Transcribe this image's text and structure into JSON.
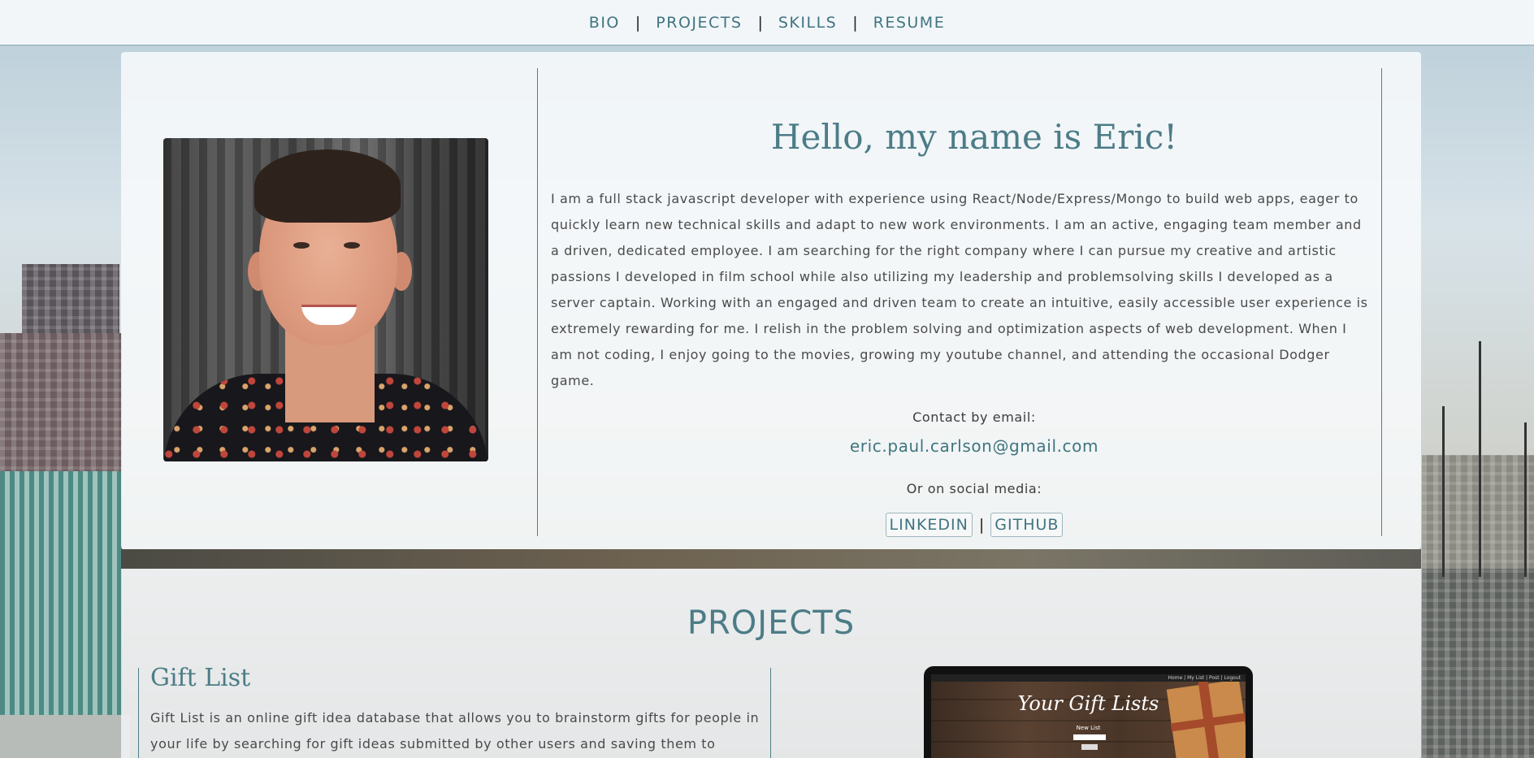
{
  "nav": {
    "items": [
      {
        "label": "BIO"
      },
      {
        "label": "PROJECTS"
      },
      {
        "label": "SKILLS"
      },
      {
        "label": "RESUME"
      }
    ],
    "separator": "|"
  },
  "bio": {
    "title": "Hello, my name is Eric!",
    "text": "I am a full stack javascript developer with experience using React/Node/Express/Mongo to build web apps, eager to quickly learn new technical skills and adapt to new work environments. I am an active, engaging team member and a driven, dedicated employee. I am searching for the right company where I can pursue my creative and artistic passions I developed in film school while also utilizing my leadership and problemsolving skills I developed as a server captain. Working with an engaged and driven team to create an intuitive, easily accessible user experience is extremely rewarding for me. I relish in the problem solving and optimization aspects of web development. When I am not coding, I enjoy going to the movies, growing my youtube channel, and attending the occasional Dodger game.",
    "contact_label": "Contact by email:",
    "email": "eric.paul.carlson@gmail.com",
    "social_label": "Or on social media:",
    "social": [
      {
        "label": "LINKEDIN"
      },
      {
        "label": "GITHUB"
      }
    ],
    "social_separator": "|"
  },
  "projects": {
    "heading": "PROJECTS",
    "items": [
      {
        "title": "Gift List",
        "description": "Gift List is an online gift idea database that allows you to brainstorm gifts for people in your life by searching for gift ideas submitted by other users and saving them to",
        "preview": {
          "nav_text": "Home | My List | Post | Logout",
          "heading": "Your Gift Lists",
          "sub_label": "New List",
          "button_label": "Add"
        }
      }
    ]
  },
  "colors": {
    "accent": "#3f7580",
    "heading": "#4c7c87",
    "text": "#4a4a4a"
  }
}
